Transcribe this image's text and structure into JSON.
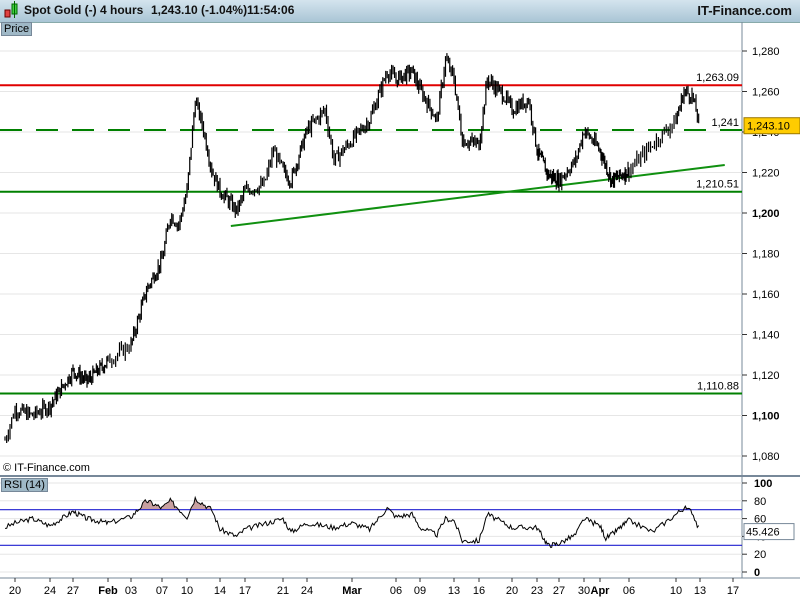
{
  "header": {
    "instrument": "Spot Gold (-)",
    "timeframe": "4 hours",
    "last": "1,243.10 (-1.04%)",
    "time": "11:54:06",
    "brand": "IT-Finance.com"
  },
  "price_panel_label": "Price",
  "copyright": "© IT-Finance.com",
  "rsi_panel_label": "RSI (14)",
  "chart_data": [
    {
      "type": "ohlc",
      "title": "Spot Gold (-)",
      "interval": "4 hours",
      "ylim": [
        1075,
        1292
      ],
      "yticks": [
        1080,
        1100,
        1120,
        1140,
        1160,
        1180,
        1200,
        1220,
        1240,
        1260,
        1280
      ],
      "ytick_labels": [
        "1,080",
        "1,100",
        "1,120",
        "1,140",
        "1,160",
        "1,180",
        "1,200",
        "1,220",
        "1,240",
        "1,260",
        "1,280"
      ],
      "last_price": 1243.1,
      "last_label": "1,243.10",
      "last_color": "#ffcc00",
      "approx_closes": [
        [
          "Jan 19",
          1088
        ],
        [
          "Jan 20",
          1103
        ],
        [
          "Jan 22",
          1100
        ],
        [
          "Jan 24",
          1105
        ],
        [
          "Jan 27",
          1122
        ],
        [
          "Jan 29",
          1117
        ],
        [
          "Feb 01",
          1127
        ],
        [
          "Feb 03",
          1135
        ],
        [
          "Feb 05",
          1162
        ],
        [
          "Feb 07",
          1177
        ],
        [
          "Feb 08",
          1199
        ],
        [
          "Feb 09",
          1194
        ],
        [
          "Feb 10",
          1211
        ],
        [
          "Feb 11",
          1256
        ],
        [
          "Feb 12",
          1241
        ],
        [
          "Feb 13",
          1221
        ],
        [
          "Feb 14",
          1211
        ],
        [
          "Feb 16",
          1201
        ],
        [
          "Feb 17",
          1211
        ],
        [
          "Feb 19",
          1214
        ],
        [
          "Feb 20",
          1231
        ],
        [
          "Feb 21",
          1221
        ],
        [
          "Feb 22",
          1216
        ],
        [
          "Feb 24",
          1241
        ],
        [
          "Feb 26",
          1251
        ],
        [
          "Feb 27",
          1226
        ],
        [
          "Mar 01",
          1236
        ],
        [
          "Mar 03",
          1246
        ],
        [
          "Mar 05",
          1270
        ],
        [
          "Mar 06",
          1266
        ],
        [
          "Mar 08",
          1270
        ],
        [
          "Mar 09",
          1261
        ],
        [
          "Mar 11",
          1246
        ],
        [
          "Mar 12",
          1276
        ],
        [
          "Mar 13",
          1266
        ],
        [
          "Mar 14",
          1236
        ],
        [
          "Mar 16",
          1234
        ],
        [
          "Mar 17",
          1266
        ],
        [
          "Mar 19",
          1258
        ],
        [
          "Mar 20",
          1251
        ],
        [
          "Mar 22",
          1256
        ],
        [
          "Mar 23",
          1231
        ],
        [
          "Mar 25",
          1219
        ],
        [
          "Mar 27",
          1216
        ],
        [
          "Mar 29",
          1226
        ],
        [
          "Mar 30",
          1241
        ],
        [
          "Apr 01",
          1231
        ],
        [
          "Apr 03",
          1216
        ],
        [
          "Apr 06",
          1221
        ],
        [
          "Apr 08",
          1234
        ],
        [
          "Apr 10",
          1246
        ],
        [
          "Apr 11",
          1260
        ],
        [
          "Apr 12",
          1258
        ],
        [
          "Apr 13",
          1243
        ]
      ],
      "levels": [
        {
          "value": 1263.09,
          "label": "1,263.09",
          "color": "#e00000",
          "style": "solid"
        },
        {
          "value": 1241,
          "label": "1,241",
          "color": "#008000",
          "style": "dashed"
        },
        {
          "value": 1210.51,
          "label": "1,210.51",
          "color": "#008000",
          "style": "solid"
        },
        {
          "value": 1110.88,
          "label": "1,110.88",
          "color": "#008000",
          "style": "solid"
        }
      ],
      "trendline": {
        "from": [
          "Feb 15",
          1193.6
        ],
        "to": [
          "Apr 16",
          1223.7
        ],
        "color": "#109010"
      },
      "grid": true
    },
    {
      "type": "line",
      "title": "RSI (14)",
      "ylim": [
        -5,
        105
      ],
      "yticks": [
        0,
        20,
        40,
        60,
        80,
        100
      ],
      "ytick_labels": [
        "0",
        "20",
        "40",
        "60",
        "80",
        "100"
      ],
      "bands": [
        30,
        70
      ],
      "band_color": "#2020d0",
      "overbought_fill": "#c8a0a0",
      "last_value": "45.426",
      "values": [
        [
          "Jan 19",
          50
        ],
        [
          "Jan 20",
          55
        ],
        [
          "Jan 22",
          60
        ],
        [
          "Jan 24",
          52
        ],
        [
          "Jan 27",
          68
        ],
        [
          "Jan 29",
          60
        ],
        [
          "Feb 01",
          55
        ],
        [
          "Feb 03",
          62
        ],
        [
          "Feb 05",
          80
        ],
        [
          "Feb 07",
          72
        ],
        [
          "Feb 08",
          80
        ],
        [
          "Feb 10",
          62
        ],
        [
          "Feb 11",
          83
        ],
        [
          "Feb 13",
          70
        ],
        [
          "Feb 14",
          48
        ],
        [
          "Feb 16",
          40
        ],
        [
          "Feb 17",
          48
        ],
        [
          "Feb 21",
          60
        ],
        [
          "Feb 22",
          45
        ],
        [
          "Feb 24",
          55
        ],
        [
          "Feb 27",
          50
        ],
        [
          "Mar 01",
          55
        ],
        [
          "Mar 03",
          48
        ],
        [
          "Mar 05",
          72
        ],
        [
          "Mar 06",
          62
        ],
        [
          "Mar 08",
          65
        ],
        [
          "Mar 09",
          50
        ],
        [
          "Mar 11",
          42
        ],
        [
          "Mar 12",
          60
        ],
        [
          "Mar 13",
          58
        ],
        [
          "Mar 14",
          35
        ],
        [
          "Mar 16",
          35
        ],
        [
          "Mar 17",
          65
        ],
        [
          "Mar 20",
          50
        ],
        [
          "Mar 23",
          50
        ],
        [
          "Mar 25",
          30
        ],
        [
          "Mar 27",
          32
        ],
        [
          "Mar 29",
          42
        ],
        [
          "Mar 30",
          60
        ],
        [
          "Apr 01",
          52
        ],
        [
          "Apr 02",
          38
        ],
        [
          "Apr 03",
          42
        ],
        [
          "Apr 06",
          58
        ],
        [
          "Apr 08",
          45
        ],
        [
          "Apr 10",
          65
        ],
        [
          "Apr 11",
          72
        ],
        [
          "Apr 12",
          68
        ],
        [
          "Apr 13",
          45.4
        ]
      ]
    }
  ],
  "x_axis": {
    "ticks": [
      "20",
      "24",
      "27",
      "Feb",
      "03",
      "07",
      "10",
      "14",
      "17",
      "21",
      "24",
      "Mar",
      "06",
      "09",
      "13",
      "16",
      "20",
      "23",
      "27",
      "30",
      "Apr",
      "06",
      "10",
      "13",
      "17"
    ]
  }
}
